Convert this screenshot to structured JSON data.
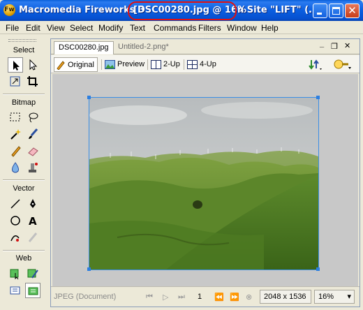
{
  "titlebar": {
    "app_name": "Macromedia Fireworks 8",
    "document": "[DSC00280.jpg @  16%",
    "site": "n Site \"LIFT\" (...",
    "icon": "fireworks-logo",
    "annotation_color": "#e01010"
  },
  "menu": [
    "File",
    "Edit",
    "View",
    "Select",
    "Modify",
    "Text",
    "Commands",
    "Filters",
    "Window",
    "Help"
  ],
  "tools": {
    "sections": [
      "Select",
      "Bitmap",
      "Vector",
      "Web"
    ],
    "icons": [
      "pointer-icon",
      "subselect-icon",
      "scale-icon",
      "crop-icon",
      "marquee-icon",
      "lasso-icon",
      "magic-wand-icon",
      "brush-icon",
      "pencil-icon",
      "eraser-icon",
      "blur-icon",
      "rubber-stamp-icon",
      "line-icon",
      "pen-icon",
      "ellipse-icon",
      "text-icon",
      "freeform-icon",
      "knife-icon",
      "hotspot-icon",
      "slice-icon",
      "hide-slices-icon",
      "show-slices-icon"
    ]
  },
  "document": {
    "tabs": [
      {
        "label": "DSC00280.jpg",
        "active": true
      },
      {
        "label": "Untitled-2.png*",
        "active": false
      }
    ],
    "view_buttons": [
      {
        "label": "Original",
        "icon": "pencil-icon",
        "active": true
      },
      {
        "label": "Preview",
        "icon": "image-icon",
        "active": false
      },
      {
        "label": "2-Up",
        "icon": "two-up-icon",
        "active": false
      },
      {
        "label": "4-Up",
        "icon": "four-up-icon",
        "active": false
      }
    ],
    "toolbar_icons": [
      "export-icon",
      "quick-export-icon"
    ],
    "status": {
      "file_type": "JPEG (Document)",
      "frame": "1",
      "dimensions": "2048 x 1536",
      "zoom": "16%"
    }
  },
  "colors": {
    "titlebar": "#0a5ee0",
    "canvas_bg": "#c8c8c8",
    "selection": "#2d7fe0"
  }
}
